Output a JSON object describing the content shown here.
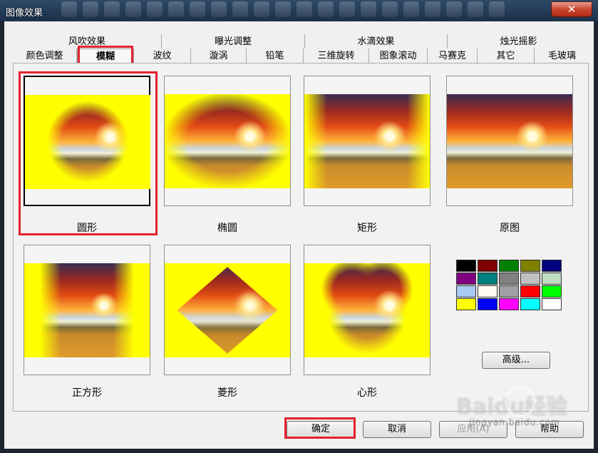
{
  "window": {
    "title": "图像效果",
    "close_glyph": "✕"
  },
  "tabs": {
    "row1": [
      "风吹效果",
      "曝光调整",
      "水滴效果",
      "烛光摇影"
    ],
    "row2": [
      "颜色调整",
      "模糊",
      "波纹",
      "漩涡",
      "铅笔",
      "三维旋转",
      "图象滚动",
      "马赛克",
      "其它",
      "毛玻璃"
    ],
    "active": "模糊"
  },
  "effects": [
    {
      "label": "圆形",
      "selected": true
    },
    {
      "label": "椭圆",
      "selected": false
    },
    {
      "label": "矩形",
      "selected": false
    },
    {
      "label": "原图",
      "selected": false
    },
    {
      "label": "正方形",
      "selected": false
    },
    {
      "label": "菱形",
      "selected": false
    },
    {
      "label": "心形",
      "selected": false
    }
  ],
  "swatches": [
    "#000000",
    "#800000",
    "#008000",
    "#808000",
    "#000080",
    "#800080",
    "#008080",
    "#808080",
    "#c0c0c0",
    "#c0dcc0",
    "#a6caf0",
    "#fffbf0",
    "#a0a0a4",
    "#ff0000",
    "#00ff00",
    "#ffff00",
    "#0000ff",
    "#ff00ff",
    "#00ffff",
    "#ffffff"
  ],
  "buttons": {
    "advanced": "高级...",
    "ok": "确定",
    "cancel": "取消",
    "apply": "应用(A)",
    "help": "帮助"
  },
  "watermark": {
    "brand": "Baidu经验",
    "url": "jingyan.baidu.com"
  },
  "colors": {
    "highlight": "#e2232f",
    "preview_bg": "#ffff00"
  }
}
